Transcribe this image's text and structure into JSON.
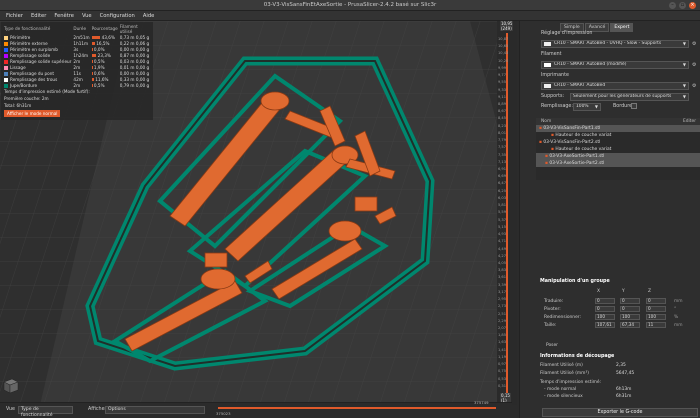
{
  "window": {
    "title": "03-V3-VisSansFinEtAxeSortie - PrusaSlicer-2.4.2 basé sur Slic3r",
    "close_label": "×",
    "min_label": "–",
    "max_label": "▫"
  },
  "menu": [
    "Fichier",
    "Editer",
    "Fenêtre",
    "Vue",
    "Configuration",
    "Aide"
  ],
  "legend": {
    "headers": [
      "Type de fonctionnalité",
      "Durée",
      "Pourcentage",
      "Filament utilisé"
    ],
    "rows": [
      {
        "name": "Périmètre",
        "time": "2m51m",
        "pct": "43,6%",
        "pct_frac": 0.436,
        "fil": "0,73 m   0,05 g",
        "color": "#ffd27f"
      },
      {
        "name": "Périmètre externe",
        "time": "1h11m",
        "pct": "16,5%",
        "pct_frac": 0.165,
        "fil": "0,22 m   0,06 g",
        "color": "#ff8a00"
      },
      {
        "name": "Périmètre en surplomb",
        "time": "3s",
        "pct": "0,0%",
        "pct_frac": 0.0,
        "fil": "0,00 m   0,00 g",
        "color": "#1f5fff"
      },
      {
        "name": "Remplissage solide",
        "time": "1h24m",
        "pct": "23,3%",
        "pct_frac": 0.233,
        "fil": "0,87 m   0,00 g",
        "color": "#b400ff"
      },
      {
        "name": "Remplissage solide supérieur",
        "time": "2m",
        "pct": "0,5%",
        "pct_frac": 0.005,
        "fil": "0,03 m   0,00 g",
        "color": "#f02626"
      },
      {
        "name": "Lissage",
        "time": "2m",
        "pct": "1,9%",
        "pct_frac": 0.019,
        "fil": "0,01 m   0,00 g",
        "color": "#ff8cb4"
      },
      {
        "name": "Remplissage du pont",
        "time": "11s",
        "pct": "0,6%",
        "pct_frac": 0.006,
        "fil": "0,00 m   0,00 g",
        "color": "#4d80ba"
      },
      {
        "name": "Remplissage des trous",
        "time": "42m",
        "pct": "11,6%",
        "pct_frac": 0.116,
        "fil": "0,33 m   0,00 g",
        "color": "#ffffff"
      },
      {
        "name": "Jupe/Bordure",
        "time": "2m",
        "pct": "0,5%",
        "pct_frac": 0.005,
        "fil": "0,79 m   0,00 g",
        "color": "#00876e"
      }
    ],
    "print_time_label": "Temps d'impression estimé (Mode furtif):",
    "first_layer_label": "Première couche:",
    "first_layer_value": "2m",
    "total_label": "Total:",
    "total_value": "6h31m",
    "show_normal_button": "Afficher le mode normal"
  },
  "vslider": {
    "top_value": "10,95",
    "top_layer": "(249)",
    "bottom_value": "0,15",
    "bottom_layer": "(1)",
    "ticks": [
      "10,87",
      "10,65",
      "10,43",
      "10,20",
      "9,99",
      "9,77",
      "9,55",
      "9,33",
      "9,11",
      "8,89",
      "8,67",
      "8,45",
      "8,23",
      "8,01",
      "7,79",
      "7,57",
      "7,35",
      "7,13",
      "6,91",
      "6,69",
      "6,47",
      "6,25",
      "6,03",
      "5,81",
      "5,59",
      "5,37",
      "5,15",
      "4,93",
      "4,71",
      "4,49",
      "4,27",
      "4,05",
      "3,83",
      "3,61",
      "3,39",
      "3,17",
      "2,95",
      "2,73",
      "2,51",
      "2,29",
      "2,07",
      "1,85",
      "1,63",
      "1,41",
      "1,19",
      "0,97",
      "0,75",
      "0,53",
      "0,31"
    ]
  },
  "hslider": {
    "left_value": "375023",
    "right_value": "375749"
  },
  "bottombar": {
    "view_label": "Vue",
    "view_value": "Type de fonctionnalité",
    "show_label": "Afficher",
    "show_value": "Options"
  },
  "sidebar": {
    "mode_tabs": [
      "Simple",
      "Avancé",
      "Expert"
    ],
    "print_settings_label": "Réglage d'impression",
    "print_settings_value": "CR10 - SMART AutoBed - UVHQ - Slow - Supports",
    "filament_label": "Filament",
    "filament_value": "CR10 - SMART AutoBed (modifié)",
    "printer_label": "Imprimante",
    "printer_value": "CR10 - SMART AutoBed",
    "supports_label": "Supports:",
    "supports_value": "Seulement pour les générateurs de supports",
    "infill_label": "Remplissage:",
    "infill_value": "100%",
    "brim_label": "Bordure:",
    "object_list": {
      "name_header": "Nom",
      "edit_header": "Editer",
      "rows": [
        {
          "label": "03-V3-VisSansFin-Part1.stl",
          "indent": 0,
          "selected": true
        },
        {
          "label": "Hauteur de couche variat",
          "indent": 2,
          "selected": false
        },
        {
          "label": "03-V3-VisSansFin-Part2.stl",
          "indent": 0,
          "selected": false
        },
        {
          "label": "Hauteur de couche variat",
          "indent": 2,
          "selected": false
        },
        {
          "label": "03-V3-AxeSortie-Part1.stl",
          "indent": 1,
          "selected": true
        },
        {
          "label": "03-V3-AxeSortie-Part2.stl",
          "indent": 1,
          "selected": true
        }
      ]
    },
    "manipulation": {
      "title": "Manipulation d'un groupe",
      "axes": [
        "X",
        "Y",
        "Z"
      ],
      "rows": [
        {
          "label": "Traduire:",
          "x": "0",
          "y": "0",
          "z": "0",
          "unit": "mm"
        },
        {
          "label": "Pivoter:",
          "x": "0",
          "y": "0",
          "z": "0",
          "unit": "°"
        },
        {
          "label": "Redimensionner:",
          "x": "100",
          "y": "100",
          "z": "100",
          "unit": "%"
        },
        {
          "label": "Taille:",
          "x": "107,61",
          "y": "67,34",
          "z": "11",
          "unit": "mm"
        }
      ],
      "drop_label": "Poser"
    },
    "slice_info": {
      "title": "Informations de découpage",
      "rows": [
        {
          "label": "Filament Utilisé (m)",
          "value": "2,35"
        },
        {
          "label": "Filament Utilisé (mm³)",
          "value": "5647,45"
        }
      ],
      "time_label": "Temps d'impression estimé:",
      "normal_label": "- mode normal",
      "normal_value": "6h13m",
      "silent_label": "- mode silencieux",
      "silent_value": "6h31m"
    },
    "export_button": "Exporter le G-code"
  },
  "colors": {
    "accent": "#e05a2b",
    "skirt": "#00876e",
    "part": "#e06a30",
    "bed": "#3a3a3a"
  }
}
